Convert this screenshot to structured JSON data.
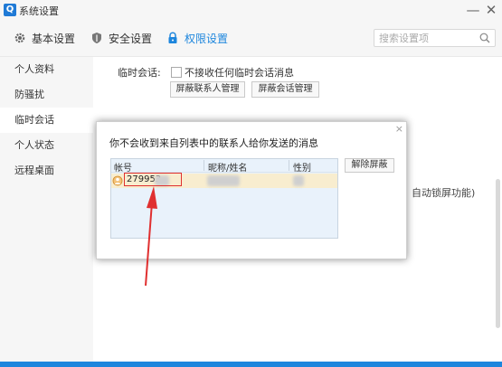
{
  "window": {
    "title": "系统设置",
    "minimize_label": "—",
    "close_label": "✕"
  },
  "tabs": [
    {
      "label": "基本设置",
      "icon": "gear-icon",
      "active": false
    },
    {
      "label": "安全设置",
      "icon": "shield-icon",
      "active": false
    },
    {
      "label": "权限设置",
      "icon": "lock-icon",
      "active": true
    }
  ],
  "search": {
    "placeholder": "搜索设置项"
  },
  "sidebar": {
    "items": [
      {
        "label": "个人资料",
        "active": false
      },
      {
        "label": "防骚扰",
        "active": false
      },
      {
        "label": "临时会话",
        "active": true
      },
      {
        "label": "个人状态",
        "active": false
      },
      {
        "label": "远程桌面",
        "active": false
      }
    ]
  },
  "main": {
    "temp_session_label": "临时会话:",
    "checkbox_label": "不接收任何临时会话消息",
    "checkbox_checked": false,
    "block_contacts_button": "屏蔽联系人管理",
    "block_sessions_button": "屏蔽会话管理",
    "partial_text": "自动锁屏功能)"
  },
  "dialog": {
    "close_label": "×",
    "title": "你不会收到来自列表中的联系人给你发送的消息",
    "columns": [
      "帐号",
      "昵称/姓名",
      "性别"
    ],
    "rows": [
      {
        "account": "279953",
        "nickname": "",
        "gender": ""
      }
    ],
    "unblock_button": "解除屏蔽"
  },
  "colors": {
    "accent": "#1d86dd",
    "highlight": "#e03030",
    "selected_row": "#f8edcf",
    "list_bg": "#e9f2fb"
  }
}
